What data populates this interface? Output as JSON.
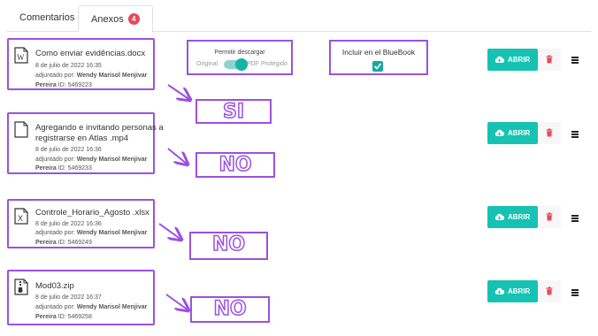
{
  "tabs": {
    "comments_label": "Comentarios",
    "attachments_label": "Anexos",
    "attachments_count": "4"
  },
  "permit_download": {
    "title": "Permitir descargar",
    "left_option": "Original",
    "right_option": "PDF Protegido",
    "enabled": true
  },
  "bluebook": {
    "label": "Incluir en el BlueBook",
    "checked": true
  },
  "actions": {
    "open_label": "ABRIR"
  },
  "files": [
    {
      "name": "Como enviar evidências.docx",
      "date": "8 de julio de 2022 16:35",
      "by_label": "adjuntado por:",
      "author": "Wendy Marisol Menjivar",
      "author_last": "Pereira",
      "id_text": "ID: 5469223",
      "icon": "word-file-icon",
      "annotation": "SI"
    },
    {
      "name_line1": "Agregando e invitando personas a",
      "name_line2": "registrarse en Atlas .mp4",
      "date": "8 de julio de 2022 16:36",
      "by_label": "adjuntado por:",
      "author": "Wendy Marisol Menjivar",
      "author_last": "Pereira",
      "id_text": "ID: 5469233",
      "icon": "file-icon",
      "annotation": "NO"
    },
    {
      "name": "Controle_Horario_Agosto .xlsx",
      "date": "8 de julio de 2022 16:36",
      "by_label": "adjuntado por:",
      "author": "Wendy Marisol Menjivar",
      "author_last": "Pereira",
      "id_text": "ID: 5469249",
      "icon": "excel-file-icon",
      "annotation": "NO"
    },
    {
      "name": "Mod03.zip",
      "date": "8 de julio de 2022 16:37",
      "by_label": "adjuntado por:",
      "author": "Wendy Marisol Menjivar",
      "author_last": "Pereira",
      "id_text": "ID: 5469258",
      "icon": "zip-file-icon",
      "annotation": "NO"
    }
  ],
  "colors": {
    "annotation_purple": "#9b51e0",
    "open_button": "#16c2b2",
    "delete_icon": "#e34a5a",
    "badge": "#e34a5a"
  }
}
